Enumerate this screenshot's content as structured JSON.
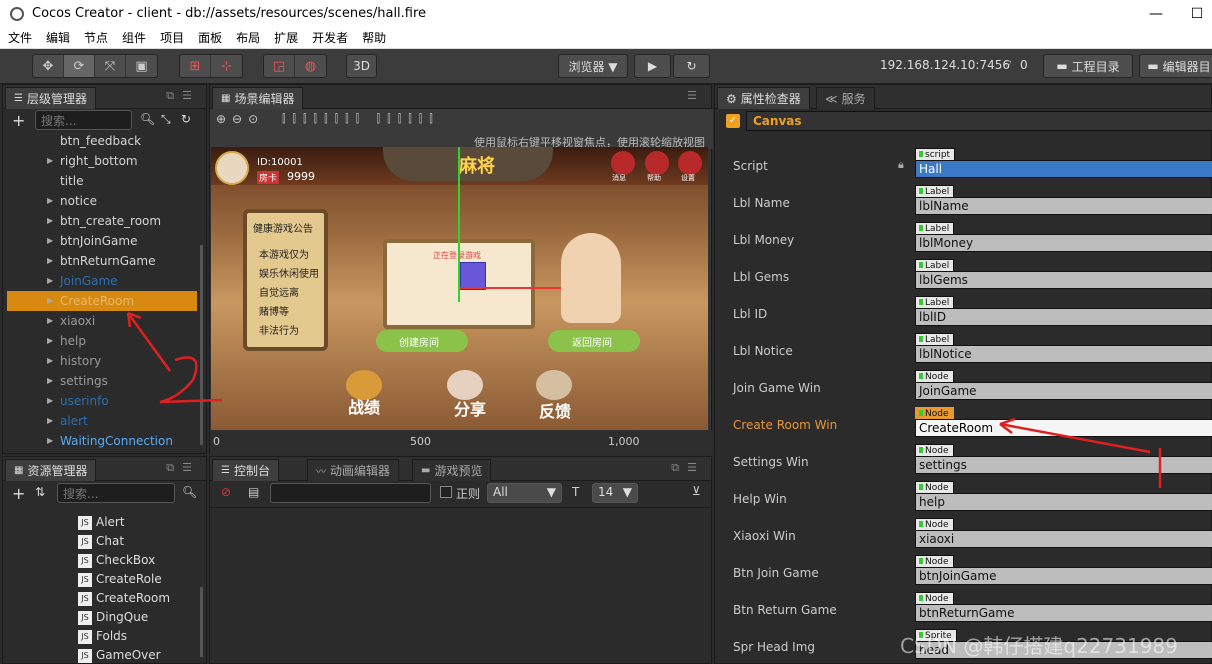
{
  "window": {
    "title": "Cocos Creator - client - db://assets/resources/scenes/hall.fire",
    "minimize": "—",
    "maximize": "☐"
  },
  "menu": [
    "文件",
    "编辑",
    "节点",
    "组件",
    "项目",
    "面板",
    "布局",
    "扩展",
    "开发者",
    "帮助"
  ],
  "toolbar": {
    "btn3d": "3D",
    "browser": "浏览器 ▼",
    "play": "▶",
    "refresh": "↻",
    "ip": "192.168.124.10:7456",
    "wifi_count": "0",
    "project_btn": "工程目录",
    "editor_btn": "编辑器目"
  },
  "hierarchy": {
    "tab": "层级管理器",
    "search_placeholder": "搜索...",
    "items": [
      {
        "label": "btn_feedback",
        "arrow": "",
        "color": "#d4d4d4",
        "selected": false
      },
      {
        "label": "right_bottom",
        "arrow": "▶",
        "color": "#d4d4d4",
        "selected": false
      },
      {
        "label": "title",
        "arrow": "",
        "color": "#d4d4d4",
        "selected": false
      },
      {
        "label": "notice",
        "arrow": "▶",
        "color": "#d4d4d4",
        "selected": false
      },
      {
        "label": "btn_create_room",
        "arrow": "▶",
        "color": "#d4d4d4",
        "selected": false
      },
      {
        "label": "btnJoinGame",
        "arrow": "▶",
        "color": "#d4d4d4",
        "selected": false
      },
      {
        "label": "btnReturnGame",
        "arrow": "▶",
        "color": "#d4d4d4",
        "selected": false
      },
      {
        "label": "JoinGame",
        "arrow": "▶",
        "color": "#2f6fb0",
        "selected": false
      },
      {
        "label": "CreateRoom",
        "arrow": "▶",
        "color": "#c68a2a",
        "selected": true
      },
      {
        "label": "xiaoxi",
        "arrow": "▶",
        "color": "#9a9a9a",
        "selected": false
      },
      {
        "label": "help",
        "arrow": "▶",
        "color": "#9a9a9a",
        "selected": false
      },
      {
        "label": "history",
        "arrow": "▶",
        "color": "#9a9a9a",
        "selected": false
      },
      {
        "label": "settings",
        "arrow": "▶",
        "color": "#9a9a9a",
        "selected": false
      },
      {
        "label": "userinfo",
        "arrow": "▶",
        "color": "#2f6fb0",
        "selected": false
      },
      {
        "label": "alert",
        "arrow": "▶",
        "color": "#2f6fb0",
        "selected": false
      },
      {
        "label": "WaitingConnection",
        "arrow": "▶",
        "color": "#5aaaf0",
        "selected": false
      }
    ]
  },
  "assets": {
    "tab": "资源管理器",
    "search_placeholder": "搜索...",
    "items": [
      "Alert",
      "Chat",
      "CheckBox",
      "CreateRole",
      "CreateRoom",
      "DingQue",
      "Folds",
      "GameOver"
    ]
  },
  "scene_editor": {
    "tab": "场景编辑器",
    "hint": "使用鼠标右键平移视窗焦点，使用滚轮缩放视图",
    "ruler_y": "500",
    "ruler_x": [
      "0",
      "500",
      "1,000"
    ],
    "game": {
      "id": "ID:10001",
      "card_label": "房卡",
      "cards": "9999",
      "logo": "麻将",
      "btn_msg": "消息",
      "btn_help": "帮助",
      "btn_set": "设置",
      "notice_title": "健康游戏公告",
      "notice_lines": [
        "本游戏仅为",
        "娱乐休闲使用",
        "自觉远离",
        "赌博等",
        "非法行为"
      ],
      "popup_title": "正在登录游戏",
      "btn_create": "创建房间",
      "btn_return": "返回房间",
      "b1": "战绩",
      "b2": "分享",
      "b3": "反馈"
    }
  },
  "console": {
    "tabs": [
      "控制台",
      "动画编辑器",
      "游戏预览"
    ],
    "regex": "正则",
    "level": "All",
    "font_size": "14"
  },
  "inspector": {
    "tabs": [
      "属性检查器",
      "服务"
    ],
    "node_name": "Canvas",
    "props": [
      {
        "label": "Script",
        "tag": "script",
        "value": "Hall",
        "highlight": false,
        "lock": true
      },
      {
        "label": "Lbl Name",
        "tag": "Label",
        "value": "lblName",
        "highlight": false
      },
      {
        "label": "Lbl Money",
        "tag": "Label",
        "value": "lblMoney",
        "highlight": false
      },
      {
        "label": "Lbl Gems",
        "tag": "Label",
        "value": "lblGems",
        "highlight": false
      },
      {
        "label": "Lbl ID",
        "tag": "Label",
        "value": "lblID",
        "highlight": false
      },
      {
        "label": "Lbl Notice",
        "tag": "Label",
        "value": "lblNotice",
        "highlight": false
      },
      {
        "label": "Join Game Win",
        "tag": "Node",
        "value": "JoinGame",
        "highlight": false
      },
      {
        "label": "Create Room Win",
        "tag": "Node",
        "value": "CreateRoom",
        "highlight": true
      },
      {
        "label": "Settings Win",
        "tag": "Node",
        "value": "settings",
        "highlight": false
      },
      {
        "label": "Help Win",
        "tag": "Node",
        "value": "help",
        "highlight": false
      },
      {
        "label": "Xiaoxi Win",
        "tag": "Node",
        "value": "xiaoxi",
        "highlight": false
      },
      {
        "label": "Btn Join Game",
        "tag": "Node",
        "value": "btnJoinGame",
        "highlight": false
      },
      {
        "label": "Btn Return Game",
        "tag": "Node",
        "value": "btnReturnGame",
        "highlight": false
      },
      {
        "label": "Spr Head Img",
        "tag": "Sprite",
        "value": "head",
        "highlight": false
      }
    ]
  },
  "watermark": "CSDN @韩仔搭建q22731989",
  "annotation_number": "2"
}
